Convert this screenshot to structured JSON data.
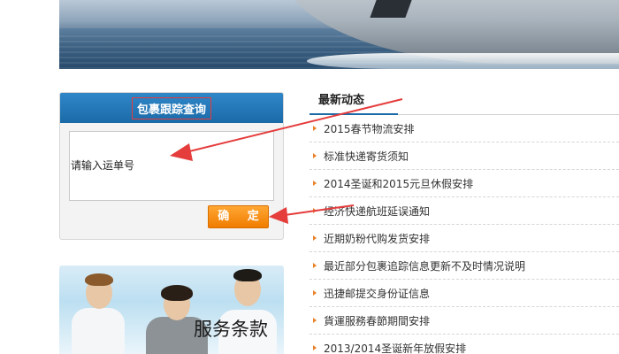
{
  "tracking": {
    "title": "包裹跟踪查询",
    "input_value": "请输入运单号",
    "confirm_label": "确 定"
  },
  "service": {
    "label": "服务条款"
  },
  "news": {
    "tab_label": "最新动态",
    "items": [
      "2015春节物流安排",
      "标准快递寄货须知",
      "2014圣诞和2015元旦休假安排",
      "经济快递航班延误通知",
      "近期奶粉代购发货安排",
      "最近部分包裹追踪信息更新不及时情况说明",
      "迅捷邮提交身份证信息",
      "貨運服務春節期間安排",
      "2013/2014圣诞新年放假安排"
    ]
  },
  "colors": {
    "accent_blue": "#1b6aa8",
    "button_orange": "#f07c00",
    "annotation_red": "#e53c3c"
  }
}
